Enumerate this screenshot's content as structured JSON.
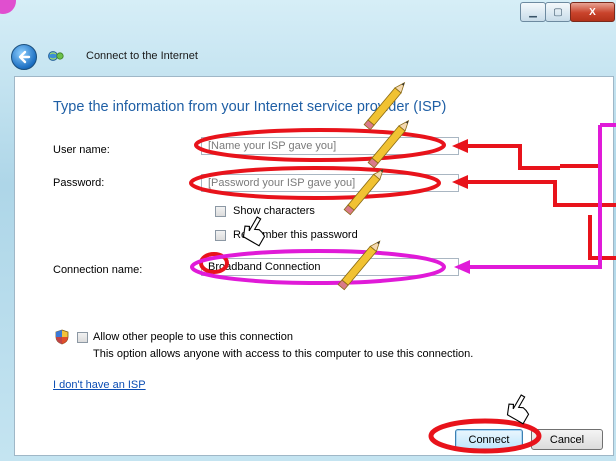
{
  "window": {
    "minimize_icon": "minimize-icon",
    "maximize_icon": "maximize-icon",
    "close_label": "X"
  },
  "nav": {
    "title": "Connect to the Internet"
  },
  "form": {
    "heading": "Type the information from your Internet service provider (ISP)",
    "username_label": "User name:",
    "username_placeholder": "[Name your ISP gave you]",
    "password_label": "Password:",
    "password_placeholder": "[Password your ISP gave you]",
    "show_characters": "Show characters",
    "remember_password": "Remember this password",
    "connection_name_label": "Connection name:",
    "connection_name_value": "Broadband Connection",
    "allow_others": "Allow other people to use this connection",
    "allow_note": "This option allows anyone with access to this computer to use this connection.",
    "no_isp_link": "I don't have an ISP"
  },
  "buttons": {
    "connect": "Connect",
    "cancel": "Cancel"
  },
  "annotation_colors": {
    "red": "#e8131b",
    "magenta": "#e01ad8"
  }
}
